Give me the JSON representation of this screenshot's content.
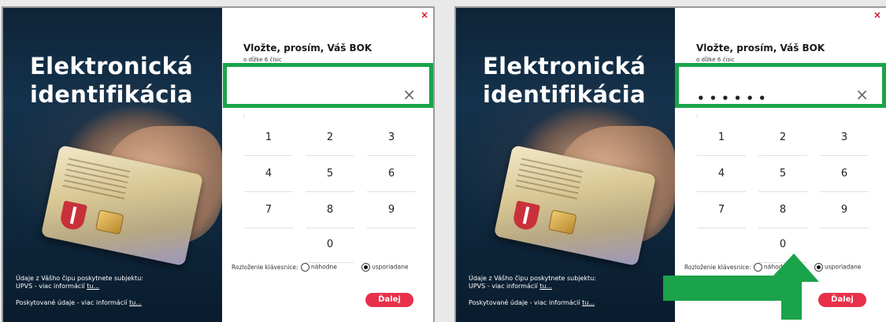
{
  "colors": {
    "highlight": "#1aa34a",
    "accent": "#e8304a",
    "close": "#d0152a"
  },
  "screens": [
    {
      "brand_title_line1": "Elektronická",
      "brand_title_line2": "identifikácia",
      "info_line1": "Údaje z Vášho čipu poskytnete subjektu:",
      "info_line2_prefix": "UPVS - viac informácií ",
      "info_line2_link": "tu...",
      "info_line3_prefix": "Poskytované údaje - viac informácií ",
      "info_line3_link": "tu...",
      "close_glyph": "×",
      "pin_title": "Vložte, prosím, Váš BOK",
      "pin_hint": "o dĺžke 6 čísic",
      "pin_value": "",
      "clear_glyph": "×",
      "keys": [
        "1",
        "2",
        "3",
        "4",
        "5",
        "6",
        "7",
        "8",
        "9",
        "0"
      ],
      "layout_label": "Rozloženie klávesnice:",
      "opt_random": "náhodne",
      "opt_ordered": "usporiadane",
      "selected_layout": "usporiadane",
      "next_label": "Ďalej"
    },
    {
      "brand_title_line1": "Elektronická",
      "brand_title_line2": "identifikácia",
      "info_line1": "Údaje z Vášho čipu poskytnete subjektu:",
      "info_line2_prefix": "UPVS - viac informácií ",
      "info_line2_link": "tu...",
      "info_line3_prefix": "Poskytované údaje - viac informácií ",
      "info_line3_link": "tu...",
      "close_glyph": "×",
      "pin_title": "Vložte, prosím, Váš BOK",
      "pin_hint": "o dĺžke 6 čísic",
      "pin_value": "••••••",
      "clear_glyph": "×",
      "keys": [
        "1",
        "2",
        "3",
        "4",
        "5",
        "6",
        "7",
        "8",
        "9",
        "0"
      ],
      "layout_label": "Rozloženie klávesnice:",
      "opt_random": "náhodne",
      "opt_ordered": "usporiadane",
      "selected_layout": "usporiadane",
      "next_label": "Ďalej"
    }
  ]
}
